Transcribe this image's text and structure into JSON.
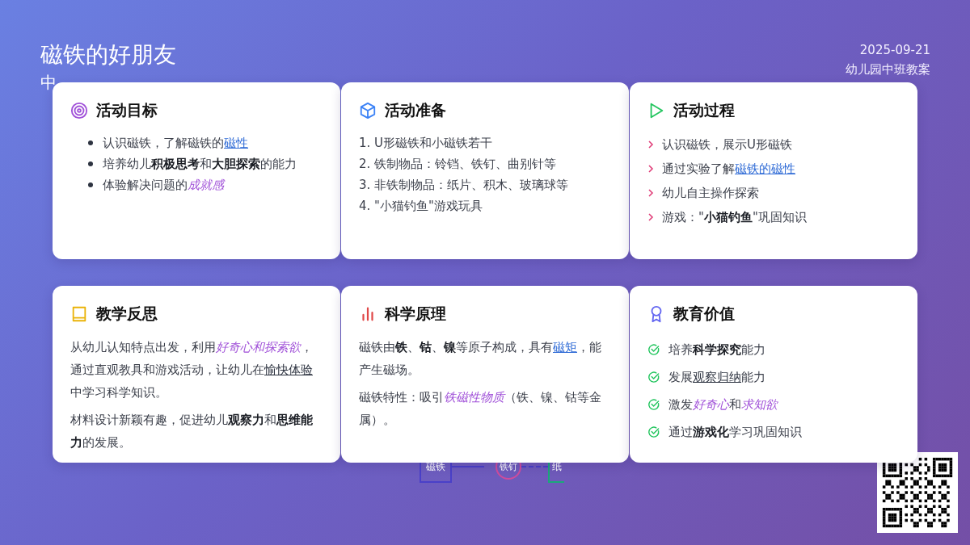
{
  "header": {
    "title": "磁铁的好朋友",
    "subtitle": "中",
    "date": "2025-09-21",
    "category": "幼儿园中班教案"
  },
  "cards": [
    {
      "title": "活动目标",
      "kind": "bullets",
      "items": [
        [
          {
            "kind": "text",
            "text": "认识磁铁，了解磁铁的"
          },
          {
            "kind": "link",
            "text": "磁性"
          }
        ],
        [
          {
            "kind": "text",
            "text": "培养幼儿"
          },
          {
            "kind": "bold",
            "text": "积极思考"
          },
          {
            "kind": "text",
            "text": "和"
          },
          {
            "kind": "bold",
            "text": "大胆探索"
          },
          {
            "kind": "text",
            "text": "的能力"
          }
        ],
        [
          {
            "kind": "text",
            "text": "体验解决问题的"
          },
          {
            "kind": "em",
            "text": "成就感"
          }
        ]
      ]
    },
    {
      "title": "活动准备",
      "kind": "numbered",
      "items": [
        [
          {
            "kind": "text",
            "text": "1. U形磁铁和小磁铁若干"
          }
        ],
        [
          {
            "kind": "text",
            "text": "2. 铁制物品：铃铛、铁钉、曲别针等"
          }
        ],
        [
          {
            "kind": "text",
            "text": "3. 非铁制物品：纸片、积木、玻璃球等"
          }
        ],
        [
          {
            "kind": "text",
            "text": "4. \"小猫钓鱼\"游戏玩具"
          }
        ]
      ]
    },
    {
      "title": "活动过程",
      "kind": "steps",
      "items": [
        [
          {
            "kind": "text",
            "text": "认识磁铁，展示U形磁铁"
          }
        ],
        [
          {
            "kind": "text",
            "text": "通过实验了解"
          },
          {
            "kind": "link",
            "text": "磁铁的磁性"
          }
        ],
        [
          {
            "kind": "text",
            "text": "幼儿自主操作探索"
          }
        ],
        [
          {
            "kind": "text",
            "text": "游戏：\""
          },
          {
            "kind": "bold",
            "text": "小猫钓鱼"
          },
          {
            "kind": "text",
            "text": "\"巩固知识"
          }
        ]
      ]
    },
    {
      "title": "教学反思",
      "kind": "paragraphs",
      "items": [
        [
          {
            "kind": "text",
            "text": "从幼儿认知特点出发，利用"
          },
          {
            "kind": "em",
            "text": "好奇心和探索欲"
          },
          {
            "kind": "text",
            "text": "，通过直观教具和游戏活动，让幼儿在"
          },
          {
            "kind": "under",
            "text": "愉快体验"
          },
          {
            "kind": "text",
            "text": "中学习科学知识。"
          }
        ],
        [
          {
            "kind": "text",
            "text": "材料设计新颖有趣，促进幼儿"
          },
          {
            "kind": "bold",
            "text": "观察力"
          },
          {
            "kind": "text",
            "text": "和"
          },
          {
            "kind": "bold",
            "text": "思维能力"
          },
          {
            "kind": "text",
            "text": "的发展。"
          }
        ]
      ]
    },
    {
      "title": "科学原理",
      "kind": "paragraphs",
      "items": [
        [
          {
            "kind": "text",
            "text": "磁铁由"
          },
          {
            "kind": "bold",
            "text": "铁"
          },
          {
            "kind": "text",
            "text": "、"
          },
          {
            "kind": "bold",
            "text": "钴"
          },
          {
            "kind": "text",
            "text": "、"
          },
          {
            "kind": "bold",
            "text": "镍"
          },
          {
            "kind": "text",
            "text": "等原子构成，具有"
          },
          {
            "kind": "link",
            "text": "磁矩"
          },
          {
            "kind": "text",
            "text": "，能产生磁场。"
          }
        ],
        [
          {
            "kind": "text",
            "text": "磁铁特性：吸引"
          },
          {
            "kind": "em",
            "text": "铁磁性物质"
          },
          {
            "kind": "text",
            "text": "（铁、镍、钴等金属）。"
          }
        ]
      ]
    },
    {
      "title": "教育价值",
      "kind": "checks",
      "items": [
        [
          {
            "kind": "text",
            "text": "培养"
          },
          {
            "kind": "bold",
            "text": "科学探究"
          },
          {
            "kind": "text",
            "text": "能力"
          }
        ],
        [
          {
            "kind": "text",
            "text": "发展"
          },
          {
            "kind": "under",
            "text": "观察归纳"
          },
          {
            "kind": "text",
            "text": "能力"
          }
        ],
        [
          {
            "kind": "text",
            "text": "激发"
          },
          {
            "kind": "em",
            "text": "好奇心"
          },
          {
            "kind": "text",
            "text": "和"
          },
          {
            "kind": "em",
            "text": "求知欲"
          }
        ],
        [
          {
            "kind": "text",
            "text": "通过"
          },
          {
            "kind": "bold",
            "text": "游戏化"
          },
          {
            "kind": "text",
            "text": "学习巩固知识"
          }
        ]
      ]
    }
  ],
  "diagram": {
    "magnet": "磁铁",
    "nail": "铁钉",
    "paper": "纸"
  }
}
